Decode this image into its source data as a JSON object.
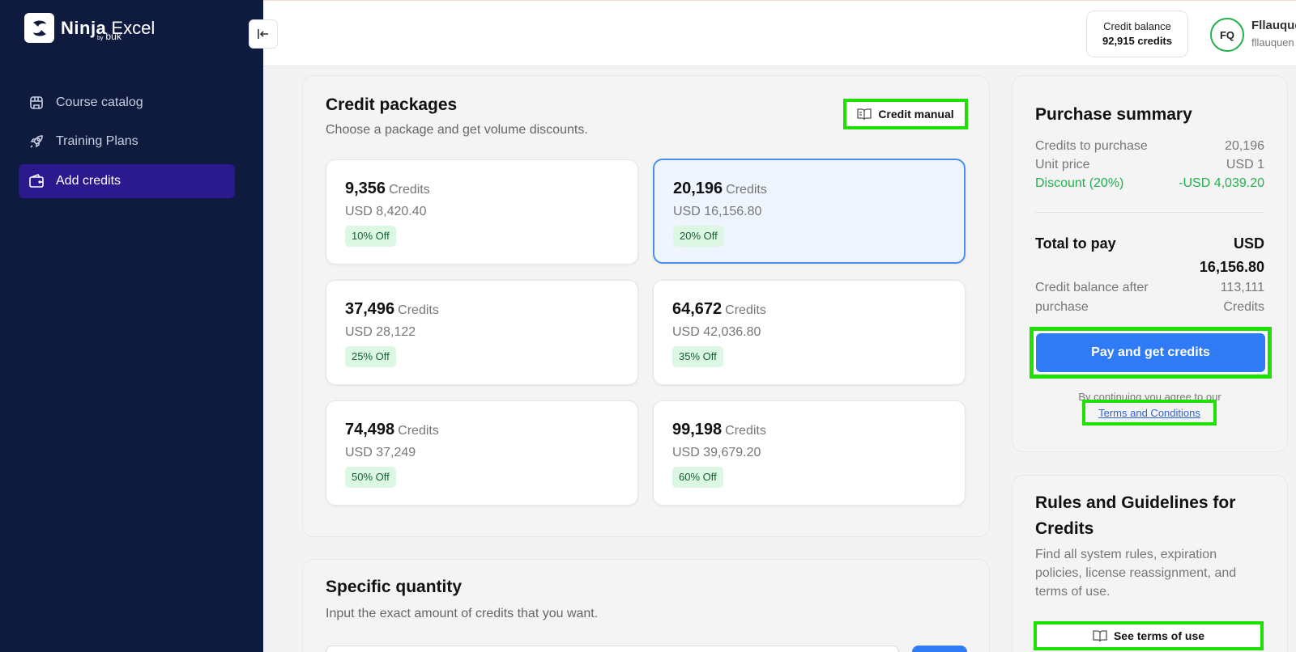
{
  "app": {
    "brand": "Ninja",
    "brand_suffix": "Excel",
    "by": "by",
    "by_brand": "buk"
  },
  "sidebar": {
    "items": [
      {
        "label": "Course catalog",
        "icon": "store-icon"
      },
      {
        "label": "Training Plans",
        "icon": "rocket-icon"
      },
      {
        "label": "Add credits",
        "icon": "wallet-icon"
      }
    ]
  },
  "header": {
    "balance_label": "Credit balance",
    "balance_value": "92,915 credits",
    "avatar_initials": "FQ",
    "user_name": "Fllauquen",
    "user_email": "fllauquen"
  },
  "packages": {
    "title": "Credit packages",
    "subtitle": "Choose a package and get volume discounts.",
    "manual_button": "Credit manual",
    "unit": "Credits",
    "items": [
      {
        "amount": "9,356",
        "price": "USD 8,420.40",
        "discount": "10% Off"
      },
      {
        "amount": "20,196",
        "price": "USD 16,156.80",
        "discount": "20% Off"
      },
      {
        "amount": "37,496",
        "price": "USD 28,122",
        "discount": "25% Off"
      },
      {
        "amount": "64,672",
        "price": "USD 42,036.80",
        "discount": "35% Off"
      },
      {
        "amount": "74,498",
        "price": "USD 37,249",
        "discount": "50% Off"
      },
      {
        "amount": "99,198",
        "price": "USD 39,679.20",
        "discount": "60% Off"
      }
    ]
  },
  "specific": {
    "title": "Specific quantity",
    "subtitle": "Input the exact amount of credits that you want."
  },
  "summary": {
    "title": "Purchase summary",
    "credits_label": "Credits to purchase",
    "credits_value": "20,196",
    "unit_price_label": "Unit price",
    "unit_price_value": "USD 1",
    "discount_label": "Discount (20%)",
    "discount_value": "-USD 4,039.20",
    "total_label": "Total to pay",
    "total_currency": "USD",
    "total_value": "16,156.80",
    "after_label": "Credit balance after purchase",
    "after_value": "113,111 Credits",
    "pay_button": "Pay and get credits",
    "agree_text": "By continuing you agree to our",
    "terms_link": "Terms and Conditions"
  },
  "rules": {
    "title": "Rules and Guidelines for Credits",
    "description": "Find all system rules, expiration policies, license reassignment, and terms of use.",
    "button": "See terms of use"
  },
  "colors": {
    "sidebar_bg": "#0f1a3f",
    "sidebar_active": "#2a1a8e",
    "primary": "#2f7bf5",
    "discount_green": "#22b14c",
    "highlight": "#1fe000"
  }
}
